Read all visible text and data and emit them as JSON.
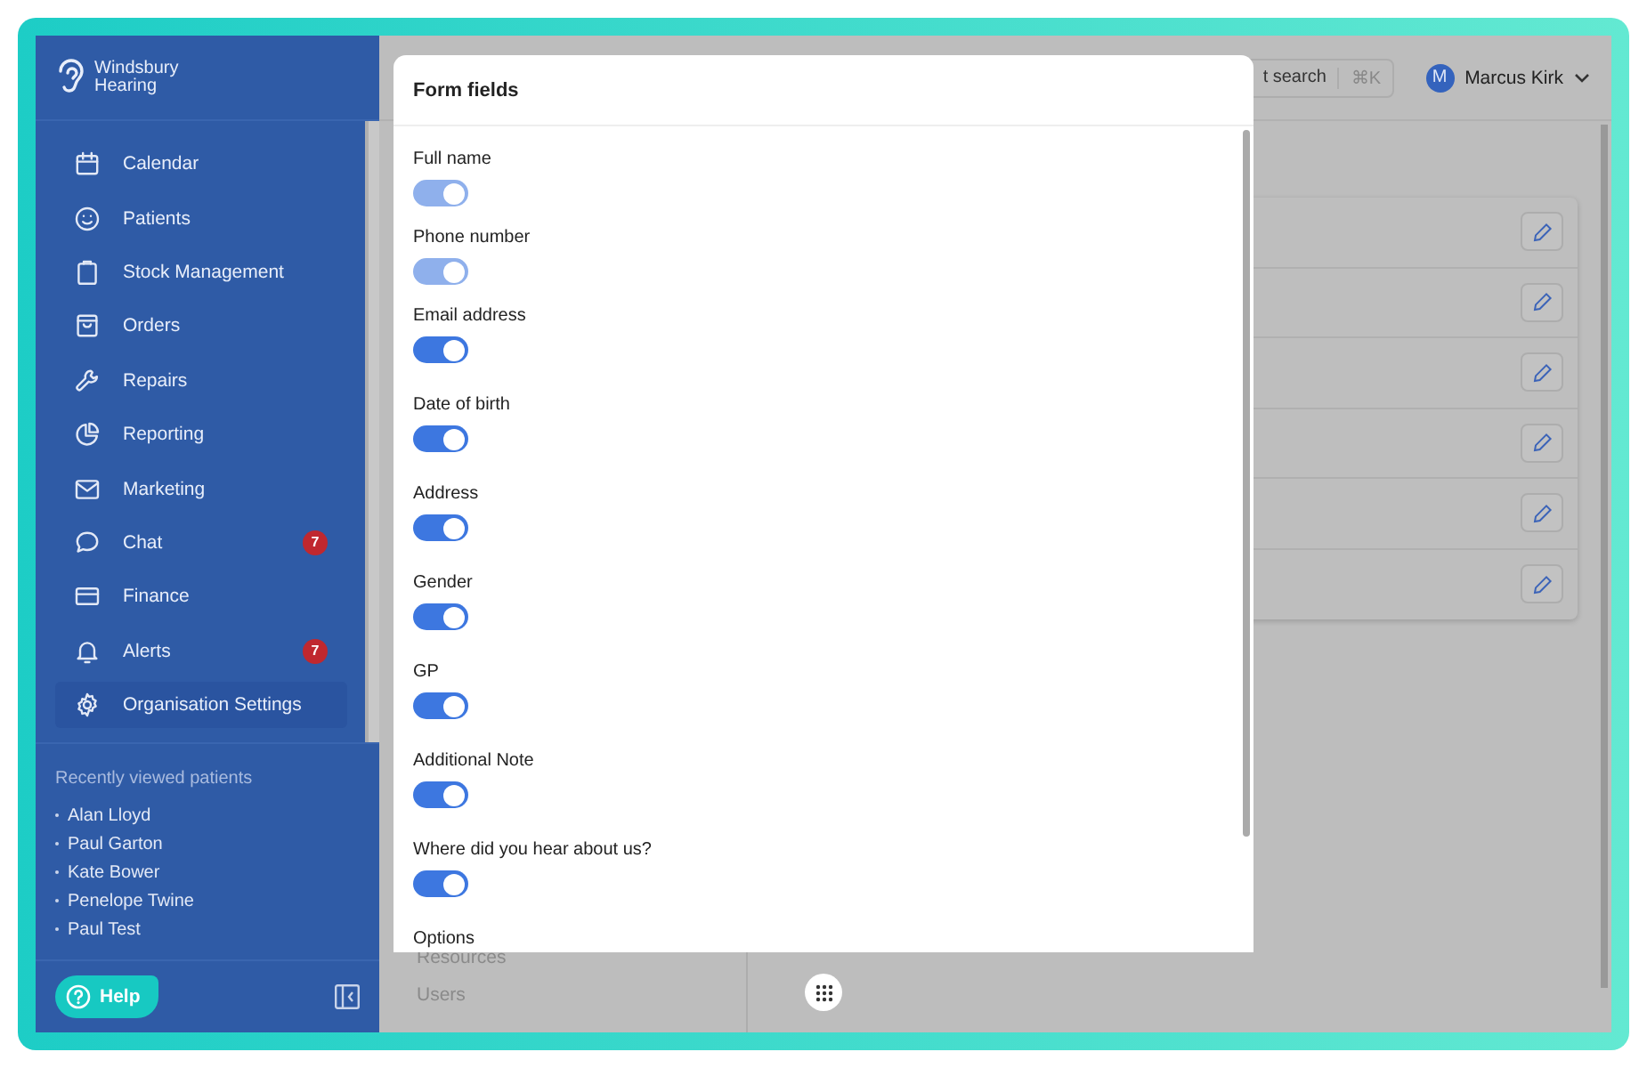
{
  "sidebar": {
    "logo": {
      "line1": "Windsbury",
      "line2": "Hearing"
    },
    "nav": [
      {
        "label": "Calendar",
        "selected": false
      },
      {
        "label": "Patients",
        "selected": false
      },
      {
        "label": "Stock Management",
        "selected": false
      },
      {
        "label": "Orders",
        "selected": false
      },
      {
        "label": "Repairs",
        "selected": false
      },
      {
        "label": "Reporting",
        "selected": false
      },
      {
        "label": "Marketing",
        "selected": false
      },
      {
        "label": "Chat",
        "selected": false,
        "badge": "7"
      },
      {
        "label": "Finance",
        "selected": false
      },
      {
        "label": "Alerts",
        "selected": false,
        "badge": "7"
      },
      {
        "label": "Organisation Settings",
        "selected": true
      }
    ],
    "recent": {
      "title": "Recently viewed patients",
      "items": [
        "Alan Lloyd",
        "Paul Garton",
        "Kate Bower",
        "Penelope Twine",
        "Paul Test"
      ]
    },
    "help": "Help"
  },
  "topbar": {
    "search": {
      "placeholder": "t search",
      "shortcut": "⌘K"
    },
    "user": {
      "initial": "M",
      "name": "Marcus Kirk"
    }
  },
  "settings_menu": {
    "items": [
      "Resources",
      "Users"
    ]
  },
  "list": {
    "rows": [
      {
        "kind": "edit"
      },
      {
        "kind": "edit"
      },
      {
        "kind": "edit"
      },
      {
        "kind": "edit"
      },
      {
        "kind": "edit"
      },
      {
        "kind": "edit"
      }
    ]
  },
  "modal": {
    "title": "Form fields",
    "fields": [
      {
        "kind": "toggle",
        "label": "Full name",
        "on": true,
        "disabled": true
      },
      {
        "kind": "toggle",
        "label": "Phone number",
        "on": true,
        "disabled": true
      },
      {
        "kind": "toggle",
        "label": "Email address",
        "on": true,
        "disabled": false
      },
      {
        "kind": "toggle",
        "label": "Date of birth",
        "on": true,
        "disabled": false
      },
      {
        "kind": "toggle",
        "label": "Address",
        "on": true,
        "disabled": false
      },
      {
        "kind": "toggle",
        "label": "Gender",
        "on": true,
        "disabled": false
      },
      {
        "kind": "toggle",
        "label": "GP",
        "on": true,
        "disabled": false
      },
      {
        "kind": "toggle",
        "label": "Additional Note",
        "on": true,
        "disabled": false
      },
      {
        "kind": "toggle",
        "label": "Where did you hear about us?",
        "on": true,
        "disabled": false
      },
      {
        "kind": "section",
        "label": "Options"
      }
    ]
  }
}
